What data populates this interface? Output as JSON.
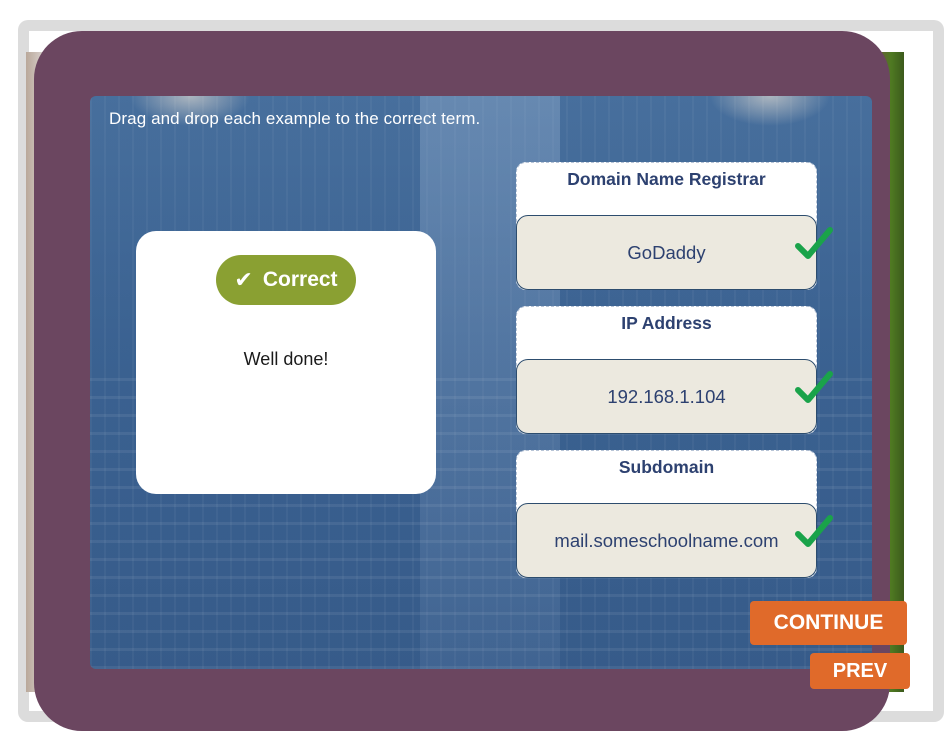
{
  "instruction": "Drag and drop each example to the correct term.",
  "feedback": {
    "badge_label": "Correct",
    "badge_icon": "checkmark-icon",
    "message": "Well done!",
    "badge_color": "#8aa032"
  },
  "terms": [
    {
      "title": "Domain Name Registrar",
      "answer": "GoDaddy",
      "status": "correct"
    },
    {
      "title": "IP Address",
      "answer": "192.168.1.104",
      "status": "correct"
    },
    {
      "title": "Subdomain",
      "answer": "mail.someschoolname.com",
      "status": "correct"
    }
  ],
  "buttons": {
    "continue_label": "CONTINUE",
    "prev_label": "PREV"
  },
  "colors": {
    "device_frame": "#6b4660",
    "button": "#e06a2a",
    "term_text": "#2d4170",
    "check_mark": "#1aa34a"
  }
}
